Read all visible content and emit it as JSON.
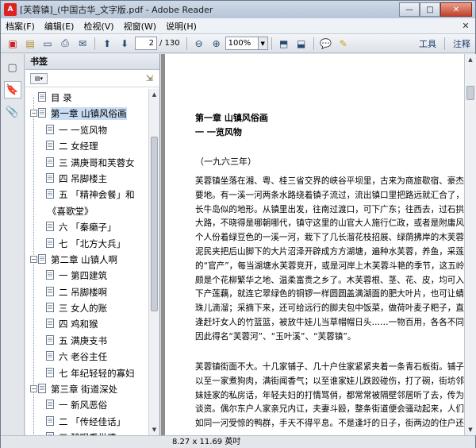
{
  "window": {
    "title": "[芙蓉镇]_(中国古华_文字版.pdf - Adobe Reader",
    "app_icon": "pdf-icon",
    "minimize": "—",
    "maximize": "□",
    "close": "✕"
  },
  "menu": {
    "items": [
      "档案(F)",
      "编辑(E)",
      "检视(V)",
      "视窗(W)",
      "说明(H)"
    ],
    "close_glyph": "✕"
  },
  "toolbar": {
    "current_page": "2",
    "total_pages": "/ 130",
    "zoom": "100%",
    "tools_label": "工具",
    "comment_label": "注释"
  },
  "bookmarks": {
    "header": "书签",
    "items": [
      {
        "label": "目  录",
        "level": 0,
        "toggle": "",
        "selected": false
      },
      {
        "label": "第一章    山镇风俗画",
        "level": 0,
        "toggle": "−",
        "selected": true
      },
      {
        "label": "一    一览风物",
        "level": 1,
        "toggle": "",
        "selected": false
      },
      {
        "label": "二    女经理",
        "level": 1,
        "toggle": "",
        "selected": false
      },
      {
        "label": "三    满庚哥和芙蓉女",
        "level": 1,
        "toggle": "",
        "selected": false
      },
      {
        "label": "四    吊脚楼主",
        "level": 1,
        "toggle": "",
        "selected": false
      },
      {
        "label": "五    「精神会餐」和",
        "level": 1,
        "toggle": "",
        "selected": false
      },
      {
        "label": "《喜歌堂》",
        "level": 1,
        "toggle": "",
        "selected": false,
        "wrap": true
      },
      {
        "label": "六    「秦癞子」",
        "level": 1,
        "toggle": "",
        "selected": false
      },
      {
        "label": "七    「北方大兵」",
        "level": 1,
        "toggle": "",
        "selected": false
      },
      {
        "label": "第二章    山镇人啊",
        "level": 0,
        "toggle": "−",
        "selected": false
      },
      {
        "label": "一    第四建筑",
        "level": 1,
        "toggle": "",
        "selected": false
      },
      {
        "label": "二    吊脚楼啊",
        "level": 1,
        "toggle": "",
        "selected": false
      },
      {
        "label": "三    女人的账",
        "level": 1,
        "toggle": "",
        "selected": false
      },
      {
        "label": "四    鸡和猴",
        "level": 1,
        "toggle": "",
        "selected": false
      },
      {
        "label": "五    满庚支书",
        "level": 1,
        "toggle": "",
        "selected": false
      },
      {
        "label": "六    老谷主任",
        "level": 1,
        "toggle": "",
        "selected": false
      },
      {
        "label": "七    年纪轻轻的寡妇",
        "level": 1,
        "toggle": "",
        "selected": false
      },
      {
        "label": "第三章    街道深处",
        "level": 0,
        "toggle": "−",
        "selected": false
      },
      {
        "label": "一    新风恶俗",
        "level": 1,
        "toggle": "",
        "selected": false
      },
      {
        "label": "二    「传经佳话」",
        "level": 1,
        "toggle": "",
        "selected": false
      },
      {
        "label": "三    醉眼看世情",
        "level": 1,
        "toggle": "",
        "selected": false
      }
    ]
  },
  "document": {
    "chapter": "第一章    山镇风俗画",
    "section": "一    一览风物",
    "year": "（一九六三年）",
    "paragraph1": [
      "芙蓉镇坐落在湘、粤、桂三省交界的峡谷平坝里，古来为商旅歇宿、豪杰聚义",
      "要地。有一溪一河两条水路绕着镇子流过，流出镇口里把路远就汇合了，因而",
      "长牛岛似的地形。从镇里出发，往南过渡口，可下广东；往西去，过石拱桥，",
      "大路，不晓得是哪朝哪代，镇守这里的山官大人施行仁政，或者是附庸风雅图",
      "个人份着绿豆色的一溪一河，栽下了几长溜花枝招展、绿荫拂岸的木芙蓉，使",
      "泥民夹把后山脚下的大片沼泽开辟成方方湖塘，遍种水芙蓉，养鱼，采莲，广",
      "的“官产”，每当湖塘水芙蓉竞开，或是河岸上木芙蓉斗艳的季节，这五岭山",
      "颇是个花柳繁华之地、温柔富贵之乡了。木芙蓉根、茎、花、皮，均可入药，水",
      "下产莲藕，就连它翠绿色的铜锣一样圆圆盖满湖面的肥大叶片，也可让蜻蜓立",
      "珠儿滴溜；采摘下来，还可给远行的脚夫包中饭菜，做荷叶麦子粑子，直小",
      "逢赶圩女人的竹篮篮，被放牛娃儿当草帽帽日头……一物百用，各各不同，长",
      "因此得名“芙蓉河”、“玉叶溪”、“芙蓉镇”。"
    ],
    "paragraph2": [
      "芙蓉镇街面不大。十几家铺子、几十户住家紧紧夹着一条青石板街。铺子和铺",
      "以至一家煮狗肉，满街闻香气；以至谁家娃儿跌跤碰伤，打了碗，街坊邻居",
      "妹娃家的私房话，年轻夫妇的打情骂俏，都常常被隔壁邻居听了去，传为一街",
      "谈资。偶尔东户人家亲兄内讧，夫妻斗殴，整条街道便会骚动起来，人们往来",
      "如同一河受惊的鸭群，手天不得平息。不是逢圩的日子，街两边的住户还会从"
    ]
  },
  "status": {
    "page_size": "8.27 x 11.69 英吋"
  }
}
